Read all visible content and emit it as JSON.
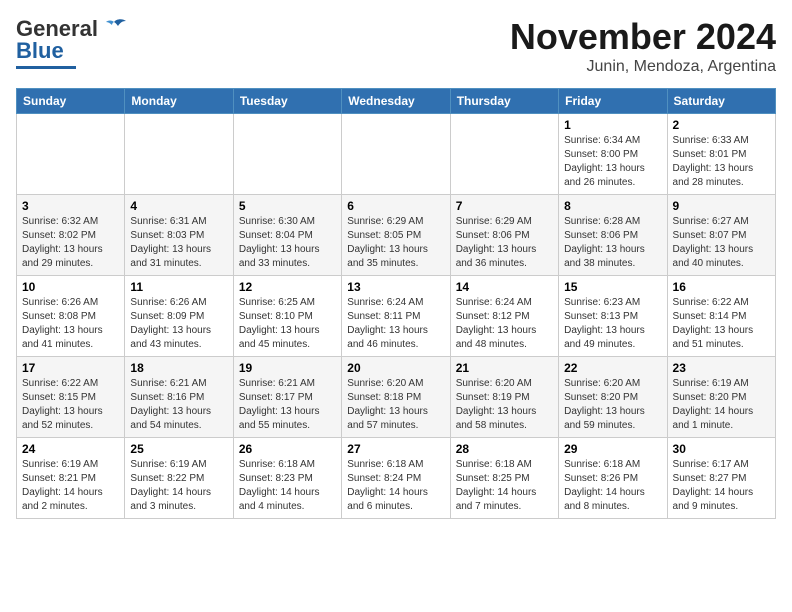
{
  "logo": {
    "part1": "General",
    "part2": "Blue"
  },
  "title": "November 2024",
  "location": "Junin, Mendoza, Argentina",
  "headers": [
    "Sunday",
    "Monday",
    "Tuesday",
    "Wednesday",
    "Thursday",
    "Friday",
    "Saturday"
  ],
  "weeks": [
    [
      {
        "day": "",
        "info": ""
      },
      {
        "day": "",
        "info": ""
      },
      {
        "day": "",
        "info": ""
      },
      {
        "day": "",
        "info": ""
      },
      {
        "day": "",
        "info": ""
      },
      {
        "day": "1",
        "info": "Sunrise: 6:34 AM\nSunset: 8:00 PM\nDaylight: 13 hours\nand 26 minutes."
      },
      {
        "day": "2",
        "info": "Sunrise: 6:33 AM\nSunset: 8:01 PM\nDaylight: 13 hours\nand 28 minutes."
      }
    ],
    [
      {
        "day": "3",
        "info": "Sunrise: 6:32 AM\nSunset: 8:02 PM\nDaylight: 13 hours\nand 29 minutes."
      },
      {
        "day": "4",
        "info": "Sunrise: 6:31 AM\nSunset: 8:03 PM\nDaylight: 13 hours\nand 31 minutes."
      },
      {
        "day": "5",
        "info": "Sunrise: 6:30 AM\nSunset: 8:04 PM\nDaylight: 13 hours\nand 33 minutes."
      },
      {
        "day": "6",
        "info": "Sunrise: 6:29 AM\nSunset: 8:05 PM\nDaylight: 13 hours\nand 35 minutes."
      },
      {
        "day": "7",
        "info": "Sunrise: 6:29 AM\nSunset: 8:06 PM\nDaylight: 13 hours\nand 36 minutes."
      },
      {
        "day": "8",
        "info": "Sunrise: 6:28 AM\nSunset: 8:06 PM\nDaylight: 13 hours\nand 38 minutes."
      },
      {
        "day": "9",
        "info": "Sunrise: 6:27 AM\nSunset: 8:07 PM\nDaylight: 13 hours\nand 40 minutes."
      }
    ],
    [
      {
        "day": "10",
        "info": "Sunrise: 6:26 AM\nSunset: 8:08 PM\nDaylight: 13 hours\nand 41 minutes."
      },
      {
        "day": "11",
        "info": "Sunrise: 6:26 AM\nSunset: 8:09 PM\nDaylight: 13 hours\nand 43 minutes."
      },
      {
        "day": "12",
        "info": "Sunrise: 6:25 AM\nSunset: 8:10 PM\nDaylight: 13 hours\nand 45 minutes."
      },
      {
        "day": "13",
        "info": "Sunrise: 6:24 AM\nSunset: 8:11 PM\nDaylight: 13 hours\nand 46 minutes."
      },
      {
        "day": "14",
        "info": "Sunrise: 6:24 AM\nSunset: 8:12 PM\nDaylight: 13 hours\nand 48 minutes."
      },
      {
        "day": "15",
        "info": "Sunrise: 6:23 AM\nSunset: 8:13 PM\nDaylight: 13 hours\nand 49 minutes."
      },
      {
        "day": "16",
        "info": "Sunrise: 6:22 AM\nSunset: 8:14 PM\nDaylight: 13 hours\nand 51 minutes."
      }
    ],
    [
      {
        "day": "17",
        "info": "Sunrise: 6:22 AM\nSunset: 8:15 PM\nDaylight: 13 hours\nand 52 minutes."
      },
      {
        "day": "18",
        "info": "Sunrise: 6:21 AM\nSunset: 8:16 PM\nDaylight: 13 hours\nand 54 minutes."
      },
      {
        "day": "19",
        "info": "Sunrise: 6:21 AM\nSunset: 8:17 PM\nDaylight: 13 hours\nand 55 minutes."
      },
      {
        "day": "20",
        "info": "Sunrise: 6:20 AM\nSunset: 8:18 PM\nDaylight: 13 hours\nand 57 minutes."
      },
      {
        "day": "21",
        "info": "Sunrise: 6:20 AM\nSunset: 8:19 PM\nDaylight: 13 hours\nand 58 minutes."
      },
      {
        "day": "22",
        "info": "Sunrise: 6:20 AM\nSunset: 8:20 PM\nDaylight: 13 hours\nand 59 minutes."
      },
      {
        "day": "23",
        "info": "Sunrise: 6:19 AM\nSunset: 8:20 PM\nDaylight: 14 hours\nand 1 minute."
      }
    ],
    [
      {
        "day": "24",
        "info": "Sunrise: 6:19 AM\nSunset: 8:21 PM\nDaylight: 14 hours\nand 2 minutes."
      },
      {
        "day": "25",
        "info": "Sunrise: 6:19 AM\nSunset: 8:22 PM\nDaylight: 14 hours\nand 3 minutes."
      },
      {
        "day": "26",
        "info": "Sunrise: 6:18 AM\nSunset: 8:23 PM\nDaylight: 14 hours\nand 4 minutes."
      },
      {
        "day": "27",
        "info": "Sunrise: 6:18 AM\nSunset: 8:24 PM\nDaylight: 14 hours\nand 6 minutes."
      },
      {
        "day": "28",
        "info": "Sunrise: 6:18 AM\nSunset: 8:25 PM\nDaylight: 14 hours\nand 7 minutes."
      },
      {
        "day": "29",
        "info": "Sunrise: 6:18 AM\nSunset: 8:26 PM\nDaylight: 14 hours\nand 8 minutes."
      },
      {
        "day": "30",
        "info": "Sunrise: 6:17 AM\nSunset: 8:27 PM\nDaylight: 14 hours\nand 9 minutes."
      }
    ]
  ]
}
